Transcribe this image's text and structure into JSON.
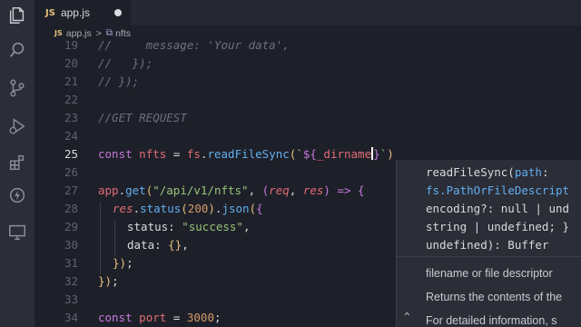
{
  "activity_bar": {
    "icons": [
      "files-icon",
      "search-icon",
      "source-control-icon",
      "run-debug-icon",
      "extensions-icon",
      "thunder-icon",
      "remote-icon"
    ]
  },
  "tabs": [
    {
      "lang_badge": "JS",
      "label": "app.js",
      "modified": true
    }
  ],
  "breadcrumb": {
    "file_badge": "JS",
    "file": "app.js",
    "separator": ">",
    "symbol": "nfts"
  },
  "editor": {
    "current_line": "25",
    "lines": [
      {
        "num": "19",
        "text": "//     message: 'Your data',",
        "kind": "comment"
      },
      {
        "num": "20",
        "text": "//   });",
        "kind": "comment"
      },
      {
        "num": "21",
        "text": "// });",
        "kind": "comment"
      },
      {
        "num": "22",
        "text": "",
        "kind": "blank"
      },
      {
        "num": "23",
        "text": "//GET REQUEST",
        "kind": "comment"
      },
      {
        "num": "24",
        "text": "",
        "kind": "blank"
      },
      {
        "num": "25",
        "text": "const nfts = fs.readFileSync(`${_dirname}`)",
        "kind": "code"
      },
      {
        "num": "26",
        "text": "",
        "kind": "blank"
      },
      {
        "num": "27",
        "text": "app.get(\"/api/v1/nfts\", (req, res) => {",
        "kind": "code"
      },
      {
        "num": "28",
        "text": "res.status(200).json({",
        "kind": "code"
      },
      {
        "num": "29",
        "text": "status: \"success\",",
        "kind": "code"
      },
      {
        "num": "30",
        "text": "data: {},",
        "kind": "code"
      },
      {
        "num": "31",
        "text": "});",
        "kind": "code"
      },
      {
        "num": "32",
        "text": "});",
        "kind": "code"
      },
      {
        "num": "33",
        "text": "",
        "kind": "blank"
      },
      {
        "num": "34",
        "text": "const port = 3000;",
        "kind": "code"
      }
    ]
  },
  "hover_popup": {
    "signature_lines": [
      "readFileSync(path:",
      "fs.PathOrFileDescript",
      "encoding?: null | und",
      "string | undefined; }",
      "undefined): Buffer"
    ],
    "doc_lines": [
      "filename or file descriptor",
      "Returns the contents of the",
      "For detailed information, s"
    ],
    "expand_glyph": "^"
  },
  "colors": {
    "background": "#1e2029",
    "keyword": "#c678dd",
    "function": "#61afef",
    "string": "#98c379",
    "number": "#d19a66",
    "comment": "#6b7080"
  }
}
